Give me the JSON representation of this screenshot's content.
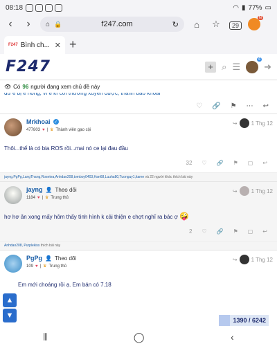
{
  "status_bar": {
    "time": "08:18",
    "battery": "77%",
    "battery_icon": "battery-icon",
    "wifi_icon": "wifi-icon"
  },
  "browser": {
    "url": "f247.com",
    "tab_count": "29",
    "profile_badge": "N",
    "tab_title": "Bình ch...",
    "tab_favicon": "F247"
  },
  "site": {
    "logo": "F247",
    "notification_count": "4"
  },
  "viewing": {
    "prefix": "Có",
    "count": "96",
    "suffix": "người đang xem chủ đề này"
  },
  "truncated_line": "dư e bị e hỏng, vì e kì cơi thường xuyên được, thanh bao khoai",
  "posts": [
    {
      "name": "Mrkhoai",
      "verified": true,
      "follow_text": "",
      "score": "477803",
      "rank": "Thành viên gạo cội",
      "date": "1 Thg 12",
      "body": "Thôi...thế là có bia ROS rồi...mai nó ce lại đau đầu",
      "emoji": "",
      "like_count": "32",
      "likes_names": "jayng,PgPg,LangThang,Rosetea,Anhdao208,tomboy0403,Han68,Luuha80,Tuonguy1,itame",
      "likes_suffix": " và 22 người khác thích bài này"
    },
    {
      "name": "jayng",
      "verified": false,
      "follow_text": "Theo dõi",
      "score": "1184",
      "rank": "Trung thủ",
      "date": "1 Thg 12",
      "body": "hơ hơ ăn xong mấy hôm thấy tình hình k cải thiện e chợt nghĩ ra bác ợ",
      "emoji": "🤪",
      "like_count": "2",
      "likes_names": "Anhdao208, Purplekiss",
      "likes_suffix": " thích bài này"
    },
    {
      "name": "PgPg",
      "verified": false,
      "follow_text": "Theo dõi",
      "score": "109",
      "rank": "Trung thủ",
      "date": "1 Thg 12",
      "body": "Em mới choáng rồi ạ. Em bán có 7.18",
      "emoji": "",
      "like_count": "",
      "likes_names": "",
      "likes_suffix": ""
    }
  ],
  "progress": {
    "current": "1390",
    "total": "6242",
    "label": "1390 / 6242",
    "fraction": 0.223
  },
  "colors": {
    "accent": "#2a6dcc",
    "link": "#1b5fa8",
    "like_heart": "#e03a57"
  }
}
